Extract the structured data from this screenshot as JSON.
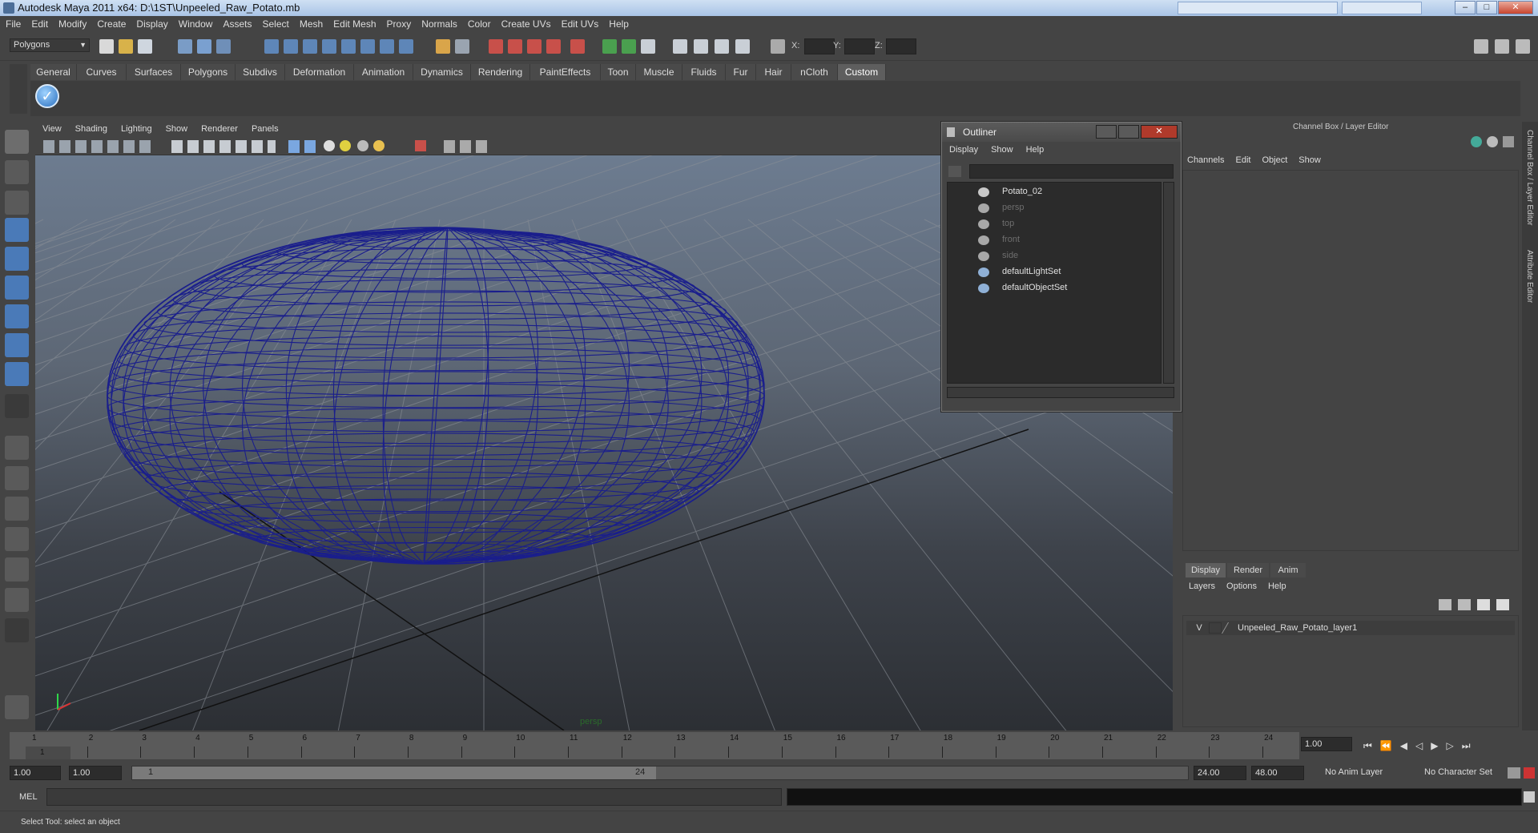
{
  "app": {
    "title": "Autodesk Maya 2011 x64: D:\\1ST\\Unpeeled_Raw_Potato.mb",
    "window_buttons": [
      "–",
      "□",
      "✕"
    ]
  },
  "menubar": {
    "items": [
      "File",
      "Edit",
      "Modify",
      "Create",
      "Display",
      "Window",
      "Assets",
      "Select",
      "Mesh",
      "Edit Mesh",
      "Proxy",
      "Normals",
      "Color",
      "Create UVs",
      "Edit UVs",
      "Help"
    ]
  },
  "statusline": {
    "mode": "Polygons",
    "x_label": "X:",
    "y_label": "Y:",
    "z_label": "Z:"
  },
  "shelf": {
    "tabs": [
      "General",
      "Curves",
      "Surfaces",
      "Polygons",
      "Subdivs",
      "Deformation",
      "Animation",
      "Dynamics",
      "Rendering",
      "PaintEffects",
      "Toon",
      "Muscle",
      "Fluids",
      "Fur",
      "Hair",
      "nCloth",
      "Custom"
    ],
    "active_tab": "Custom"
  },
  "viewport": {
    "menu": [
      "View",
      "Shading",
      "Lighting",
      "Show",
      "Renderer",
      "Panels"
    ],
    "camera_label": "persp",
    "wire_color": "#1a1e8c"
  },
  "outliner": {
    "title": "Outliner",
    "menu": [
      "Display",
      "Show",
      "Help"
    ],
    "items": [
      {
        "label": "Potato_02",
        "dim": false,
        "icon": "mesh-icon"
      },
      {
        "label": "persp",
        "dim": true,
        "icon": "camera-icon"
      },
      {
        "label": "top",
        "dim": true,
        "icon": "camera-icon"
      },
      {
        "label": "front",
        "dim": true,
        "icon": "camera-icon"
      },
      {
        "label": "side",
        "dim": true,
        "icon": "camera-icon"
      },
      {
        "label": "defaultLightSet",
        "dim": false,
        "icon": "set-icon"
      },
      {
        "label": "defaultObjectSet",
        "dim": false,
        "icon": "set-icon"
      }
    ]
  },
  "channelbox": {
    "header": "Channel Box / Layer Editor",
    "menu": [
      "Channels",
      "Edit",
      "Object",
      "Show"
    ],
    "side_tabs": [
      "Channel Box / Layer Editor",
      "Attribute Editor"
    ]
  },
  "layer_editor": {
    "tabs": [
      "Display",
      "Render",
      "Anim"
    ],
    "active_tab": "Display",
    "menu": [
      "Layers",
      "Options",
      "Help"
    ],
    "layer": {
      "visibility": "V",
      "name": "Unpeeled_Raw_Potato_layer1"
    }
  },
  "timeslider": {
    "ticks": [
      "1",
      "2",
      "3",
      "4",
      "5",
      "6",
      "7",
      "8",
      "9",
      "10",
      "11",
      "12",
      "13",
      "14",
      "15",
      "16",
      "17",
      "18",
      "19",
      "20",
      "21",
      "22",
      "23",
      "24"
    ],
    "current_frame": "1",
    "current_time": "1.00"
  },
  "range": {
    "start": "1.00",
    "anim_start": "1.00",
    "range_start_label": "1",
    "range_end_label": "24",
    "end": "24.00",
    "anim_end": "48.00",
    "anim_layer": "No Anim Layer",
    "character_set": "No Character Set"
  },
  "cmdline": {
    "label": "MEL"
  },
  "helpline": {
    "text": "Select Tool: select an object"
  }
}
